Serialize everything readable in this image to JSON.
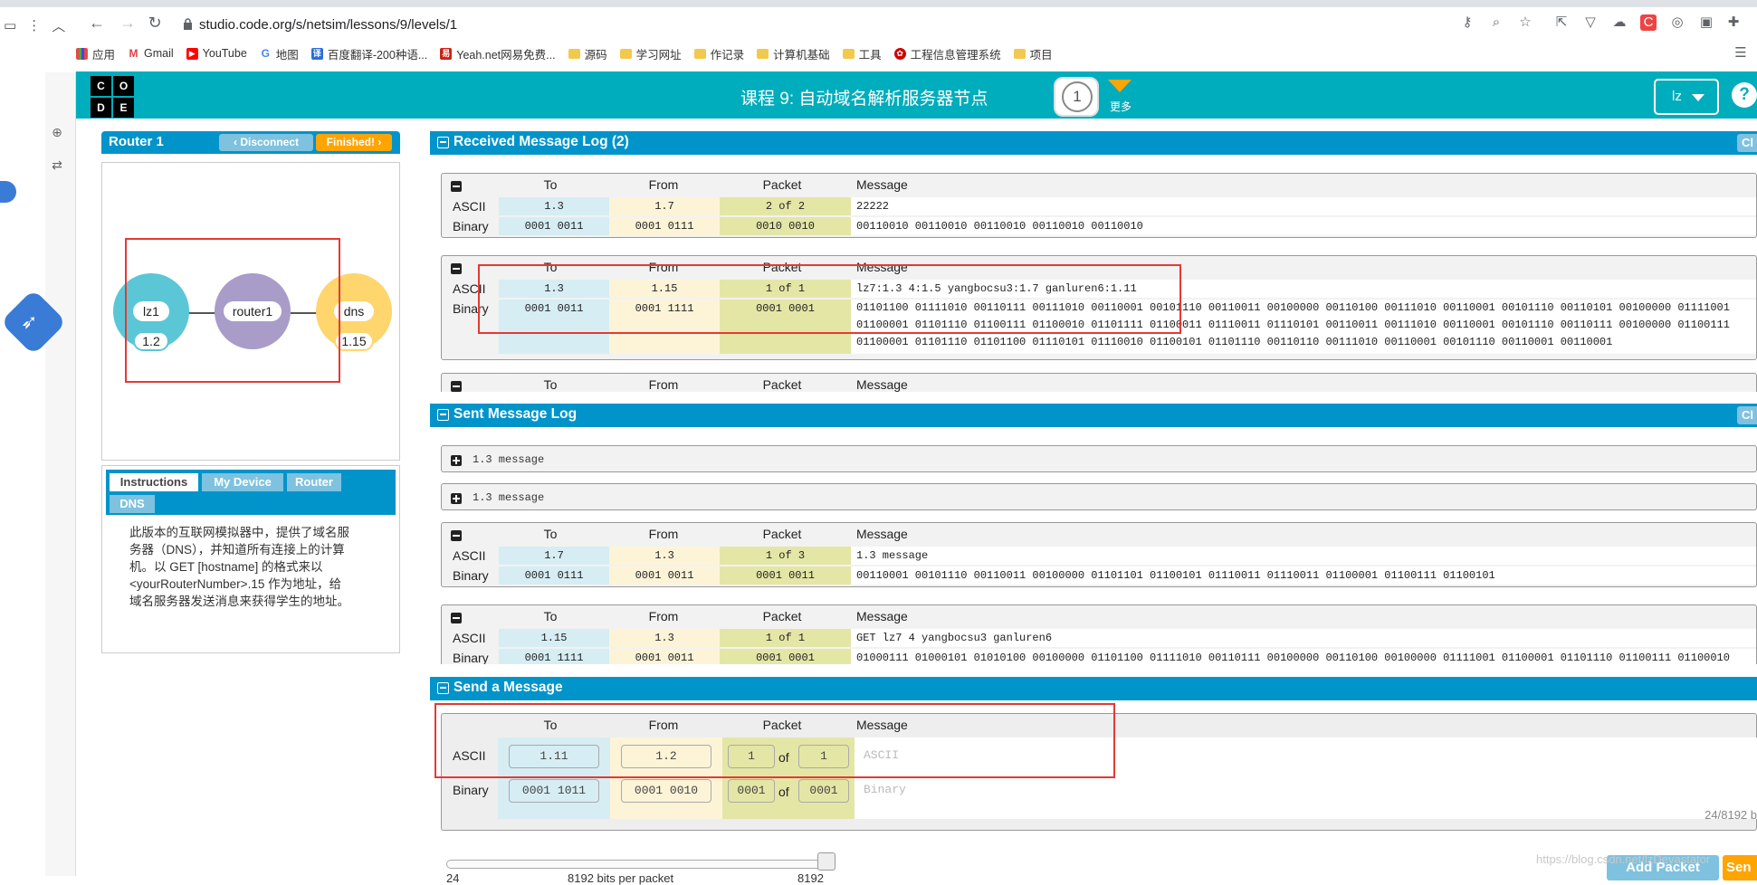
{
  "browser": {
    "url": "studio.code.org/s/netsim/lessons/9/levels/1",
    "bookmarks": [
      {
        "label": "应用",
        "icon": "apps-grid-icon"
      },
      {
        "label": "Gmail",
        "icon": "gmail-icon"
      },
      {
        "label": "YouTube",
        "icon": "youtube-icon"
      },
      {
        "label": "地图",
        "icon": "google-g-icon"
      },
      {
        "label": "百度翻译-200种语...",
        "icon": "baidu-translate-icon"
      },
      {
        "label": "Yeah.net网易免费...",
        "icon": "netease-icon"
      },
      {
        "label": "源码",
        "icon": "folder-icon"
      },
      {
        "label": "学习网址",
        "icon": "folder-icon"
      },
      {
        "label": "作记录",
        "icon": "folder-icon"
      },
      {
        "label": "计算机基础",
        "icon": "folder-icon"
      },
      {
        "label": "工具",
        "icon": "folder-icon"
      },
      {
        "label": "工程信息管理系统",
        "icon": "huawei-icon"
      },
      {
        "label": "项目",
        "icon": "folder-icon"
      }
    ]
  },
  "header": {
    "logo_letters": [
      "C",
      "O",
      "D",
      "E"
    ],
    "lesson_title": "课程 9: 自动域名解析服务器节点",
    "level_number": "1",
    "more_label": "更多",
    "user_name": "lz",
    "help_label": "?"
  },
  "router_panel": {
    "title": "Router 1",
    "disconnect_label": "Disconnect",
    "finished_label": "Finished!"
  },
  "network": {
    "nodes": [
      {
        "name": "lz1",
        "address": "1.2",
        "color": "#5bc7d6"
      },
      {
        "name": "router1",
        "address": "",
        "color": "#a99cc9"
      },
      {
        "name": "dns",
        "address": "1.15",
        "color": "#ffd56e"
      }
    ]
  },
  "instructions": {
    "tabs": [
      "Instructions",
      "My Device",
      "Router",
      "DNS"
    ],
    "active_tab": "Instructions",
    "text_lines": [
      "此版本的互联网模拟器中，提供了域名服",
      "务器（DNS），并知道所有连接上的计算",
      "机。以 GET [hostname] 的格式来以",
      "<yourRouterNumber>.15 作为地址，给",
      "域名服务器发送消息来获得学生的地址。"
    ]
  },
  "columns": {
    "to": "To",
    "from": "From",
    "packet": "Packet",
    "message": "Message",
    "ascii": "ASCII",
    "binary": "Binary",
    "of": "of"
  },
  "received_log": {
    "title": "Received Message Log (2)",
    "clear_label": "Cl",
    "messages": [
      {
        "to_ascii": "1.3",
        "from_ascii": "1.7",
        "packet_ascii": "2 of 2",
        "message_ascii": "22222",
        "to_bin": "0001 0011",
        "from_bin": "0001 0111",
        "packet_bin": "0010 0010",
        "message_bin": [
          "00110010 00110010 00110010 00110010 00110010"
        ]
      },
      {
        "to_ascii": "1.3",
        "from_ascii": "1.15",
        "packet_ascii": "1 of 1",
        "message_ascii": "lz7:1.3 4:1.5 yangbocsu3:1.7 ganluren6:1.11",
        "to_bin": "0001 0011",
        "from_bin": "0001 1111",
        "packet_bin": "0001 0001",
        "message_bin": [
          "01101100 01111010 00110111 00111010 00110001 00101110 00110011 00100000 00110100 00111010 00110001 00101110 00110101 00100000 01111001",
          "01100001 01101110 01100111 01100010 01101111 01100011 01110011 01110101 00110011 00111010 00110001 00101110 00110111 00100000 01100111",
          "01100001 01101110 01101100 01110101 01110010 01100101 01101110 00110110 00111010 00110001 00101110 00110001 00110001"
        ]
      }
    ],
    "partial_header": true
  },
  "sent_log": {
    "title": "Sent Message Log",
    "clear_label": "Cl",
    "collapsed": [
      "1.3 message",
      "1.3 message"
    ],
    "messages": [
      {
        "to_ascii": "1.7",
        "from_ascii": "1.3",
        "packet_ascii": "1 of 3",
        "message_ascii": "1.3 message",
        "to_bin": "0001 0111",
        "from_bin": "0001 0011",
        "packet_bin": "0001 0011",
        "message_bin": [
          "00110001 00101110 00110011 00100000 01101101 01100101 01110011 01110011 01100001 01100111 01100101"
        ]
      },
      {
        "to_ascii": "1.15",
        "from_ascii": "1.3",
        "packet_ascii": "1 of 1",
        "message_ascii": "GET lz7 4 yangbocsu3 ganluren6",
        "to_bin": "0001 1111",
        "from_bin": "0001 0011",
        "packet_bin": "0001 0001",
        "message_bin": [
          "01000111 01000101 01010100 00100000 01101100 01111010 00110111 00100000 00110100 00100000 01111001 01100001 01101110 01100111 01100010"
        ]
      }
    ]
  },
  "send_panel": {
    "title": "Send a Message",
    "to_ascii": "1.11",
    "from_ascii": "1.2",
    "packet_num": "1",
    "packet_total": "1",
    "message_placeholder": "ASCII",
    "to_bin": "0001 1011",
    "from_bin": "0001 0010",
    "packet_num_bin": "0001",
    "packet_total_bin": "0001",
    "binary_placeholder": "Binary",
    "bits_count": "24/8192 b",
    "slider_min": "24",
    "slider_mid": "8192 bits per packet",
    "slider_max": "8192",
    "slider_value_fraction": 1.0,
    "add_packet_label": "Add Packet",
    "send_label": "Sen"
  },
  "watermark": "https://blog.csdn.net/lzDevastator"
}
